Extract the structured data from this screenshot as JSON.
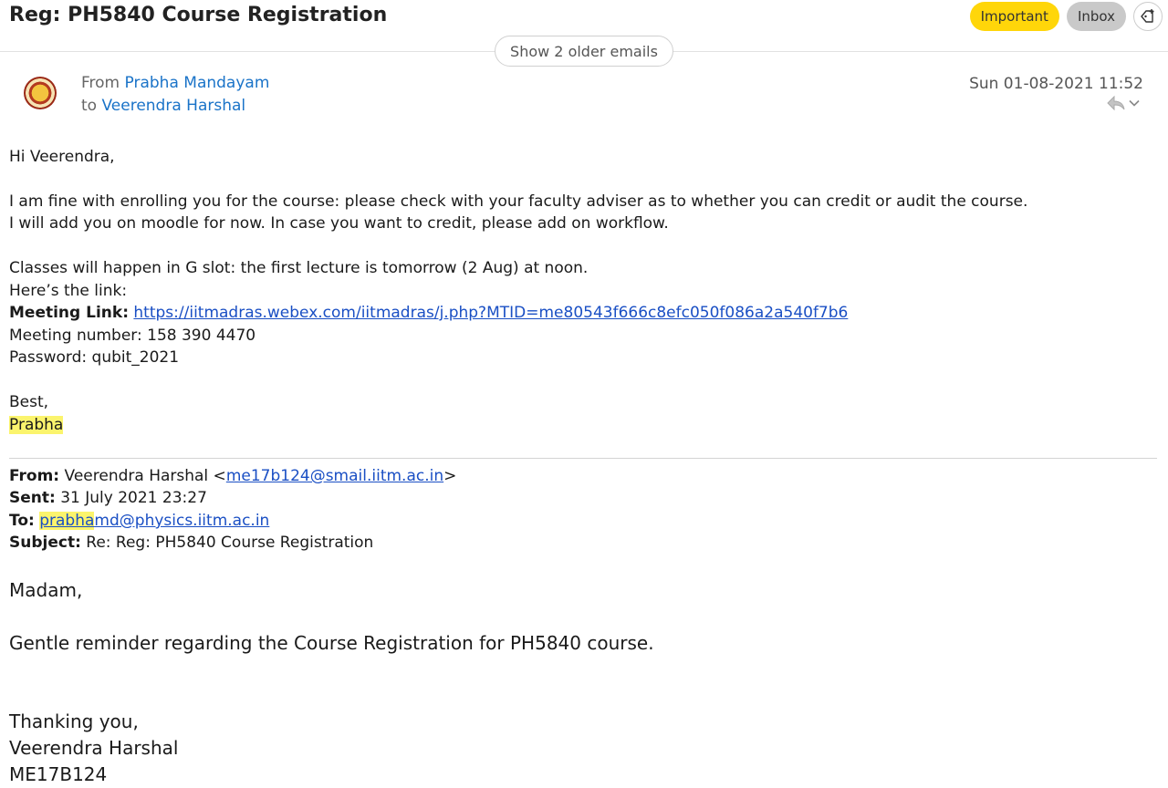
{
  "header": {
    "subject": "Reg: PH5840 Course Registration",
    "tags": {
      "important": "Important",
      "inbox": "Inbox"
    },
    "older_emails": "Show 2 older emails"
  },
  "message": {
    "from_prefix": "From",
    "from_name": "Prabha Mandayam",
    "to_prefix": "to",
    "to_name": "Veerendra Harshal",
    "date": "Sun 01-08-2021 11:52",
    "body": {
      "greeting": "Hi Veerendra,",
      "p1_line1": "I am fine with enrolling you for the course: please check with your faculty adviser as to whether you can credit or audit the course.",
      "p1_line2": "I will add you on moodle for now. In case you want to credit, please add on workflow.",
      "p2_line1": "Classes will happen in G slot: the first lecture is tomorrow (2 Aug) at noon.",
      "p2_line2": "Here’s the link:",
      "meeting_link_label": "Meeting Link:",
      "meeting_link_url": "https://iitmadras.webex.com/iitmadras/j.php?MTID=me80543f666c8efc050f086a2a540f7b6",
      "meeting_number": "Meeting number: 158 390 4470",
      "password": "Password: qubit_2021",
      "closing": "Best,",
      "signature": "Prabha"
    }
  },
  "quoted": {
    "from_label": "From:",
    "from_name": "Veerendra Harshal <",
    "from_email": "me17b124@smail.iitm.ac.in",
    "from_close": ">",
    "sent_label": "Sent:",
    "sent_value": "31 July 2021 23:27",
    "to_label": "To:",
    "to_email_highlight": "prabha",
    "to_email_rest": "md@physics.iitm.ac.in",
    "subject_label": "Subject:",
    "subject_value": "Re: Reg: PH5840 Course Registration",
    "salutation": "Madam,",
    "body": "Gentle reminder regarding the Course Registration for PH5840 course.",
    "thanks": "Thanking you,",
    "name": "Veerendra Harshal",
    "roll": "ME17B124"
  },
  "colors": {
    "important_tag": "#ffd60a",
    "inbox_tag": "#c9c9c9",
    "link": "#1a73c8",
    "highlight": "#fbf46d"
  }
}
